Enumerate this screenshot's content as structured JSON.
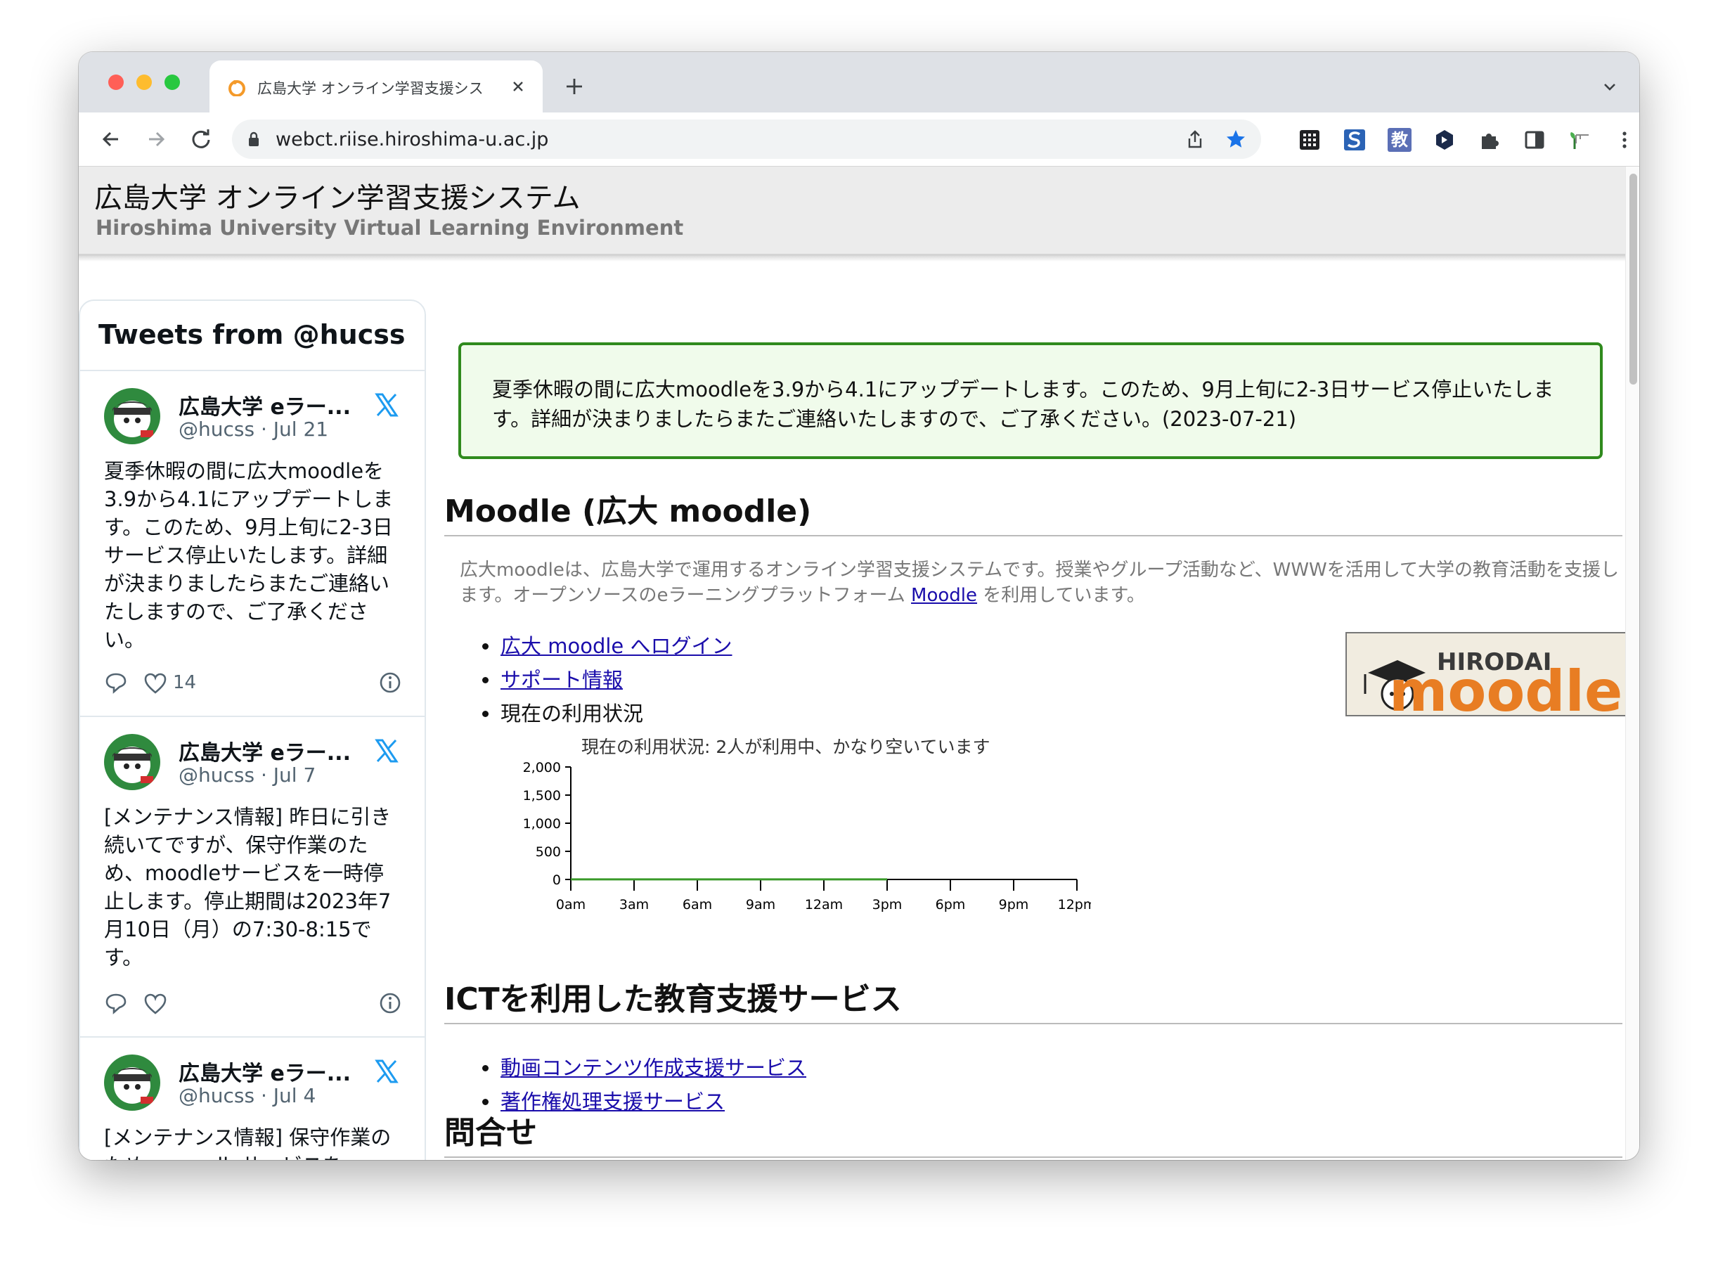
{
  "browser": {
    "tab_title": "広島大学 オンライン学習支援シス",
    "url": "webct.riise.hiroshima-u.ac.jp",
    "extensions": [
      "grid-icon",
      "s-icon",
      "kyo-icon",
      "hex-icon",
      "puzzle-icon",
      "sidepanel-icon",
      "plant-icon",
      "menu-icon"
    ],
    "ext_kyo_label": "教"
  },
  "site": {
    "title": "広島大学 オンライン学習支援システム",
    "subtitle": "Hiroshima University Virtual Learning Environment"
  },
  "twitter": {
    "header": "Tweets from @hucss",
    "tweets": [
      {
        "name": "広島大学 eラー...",
        "handle": "@hucss · Jul 21",
        "text": "夏季休暇の間に広大moodleを3.9から4.1にアップデートします。このため、9月上旬に2-3日サービス停止いたします。詳細が決まりましたらまたご連絡いたしますので、ご了承ください。",
        "likes": "14"
      },
      {
        "name": "広島大学 eラー...",
        "handle": "@hucss · Jul 7",
        "text": "[メンテナンス情報] 昨日に引き続いてですが、保守作業のため、moodleサービスを一時停止します。停止期間は2023年7月10日（月）の7:30-8:15です。",
        "likes": ""
      },
      {
        "name": "広島大学 eラー...",
        "handle": "@hucss · Jul 4",
        "text": "[メンテナンス情報] 保守作業のため、moodleサービスを",
        "likes": ""
      }
    ]
  },
  "notice": {
    "text": "夏季休暇の間に広大moodleを3.9から4.1にアップデートします。このため、9月上旬に2-3日サービス停止いたします。詳細が決まりましたらまたご連絡いたしますので、ご了承ください。(2023-07-21)"
  },
  "moodle_section": {
    "heading": "Moodle (広大 moodle)",
    "intro_before": "広大moodleは、広島大学で運用するオンライン学習支援システムです。授業やグループ活動など、WWWを活用して大学の教育活動を支援します。オープンソースのeラーニングプラットフォーム ",
    "intro_link": "Moodle",
    "intro_after": " を利用しています。",
    "links": {
      "login": "広大 moodle へログイン",
      "support": "サポート情報"
    },
    "status_item": "現在の利用状況",
    "logo_top": "HIRODAI",
    "logo_bottom": "moodle"
  },
  "chart_data": {
    "type": "line",
    "title": "現在の利用状況: 2人が利用中、かなり空いています",
    "categories": [
      "0am",
      "3am",
      "6am",
      "9am",
      "12am",
      "3pm",
      "6pm",
      "9pm",
      "12pm"
    ],
    "y_ticks": [
      "2,000",
      "1,500",
      "1,000",
      "500",
      "0"
    ],
    "ylim": [
      0,
      2000
    ],
    "series": [
      {
        "x": [
          0,
          1,
          2,
          3,
          4,
          5
        ],
        "values": [
          2,
          2,
          2,
          2,
          2,
          2
        ]
      }
    ],
    "series_color": "#3a9a2a"
  },
  "ict_section": {
    "heading": "ICTを利用した教育支援サービス",
    "links": [
      "動画コンテンツ作成支援サービス",
      "著作権処理支援サービス"
    ]
  },
  "contact_section": {
    "heading": "問合せ"
  }
}
